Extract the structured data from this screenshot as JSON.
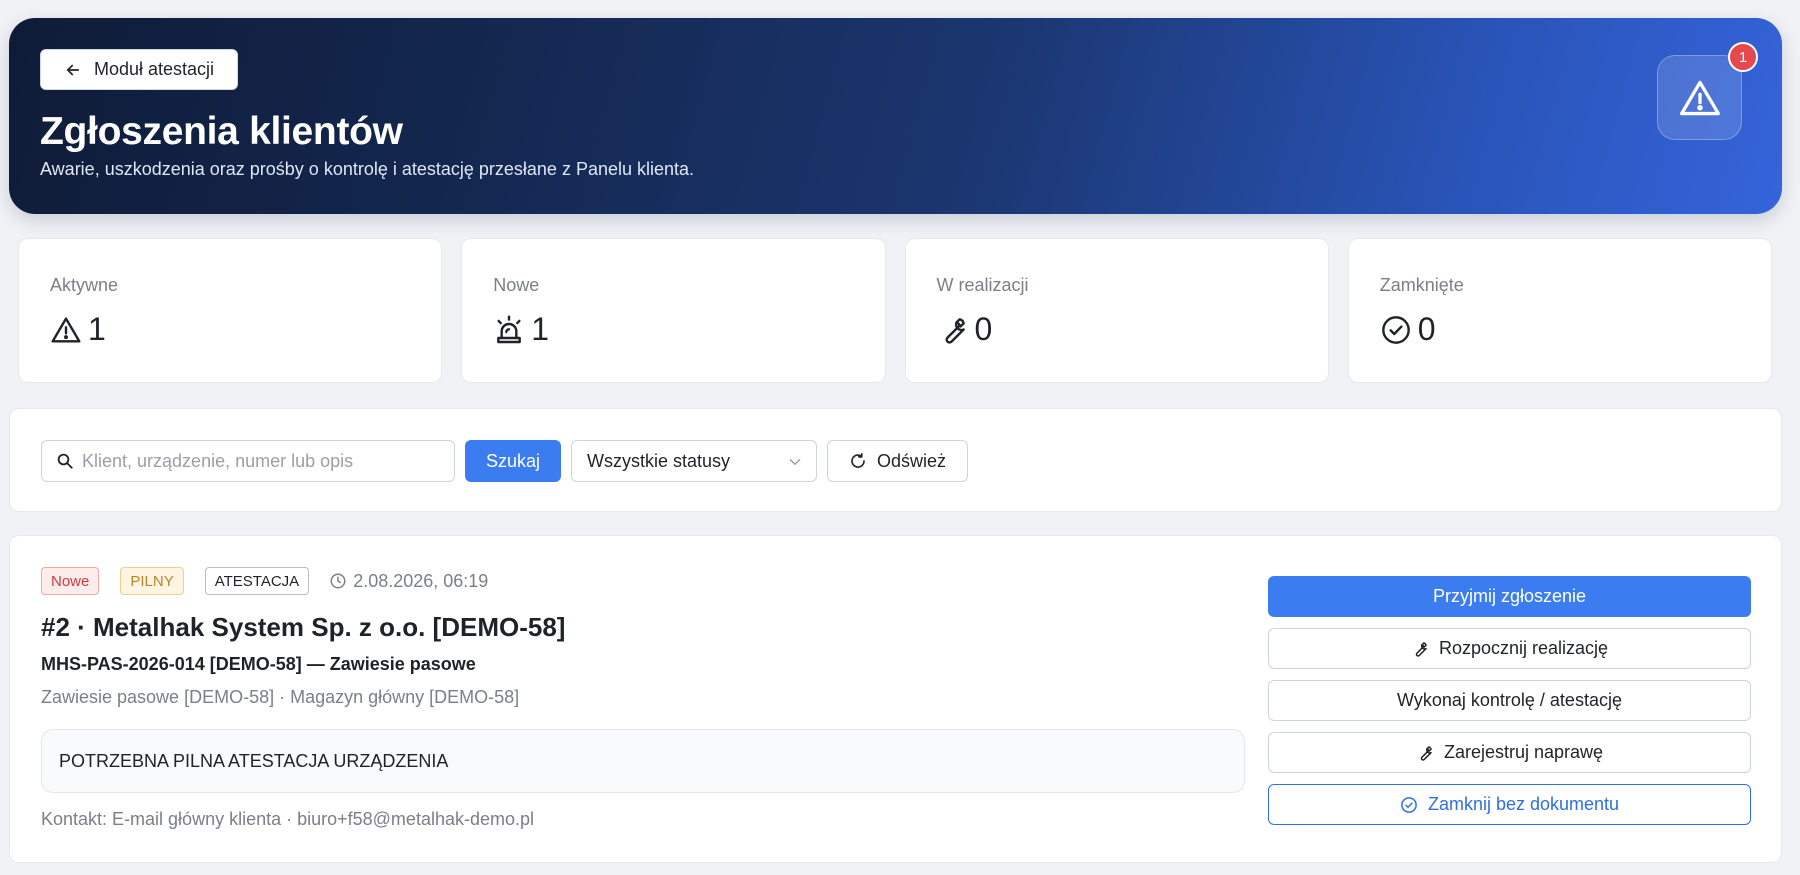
{
  "header": {
    "back_label": "Moduł atestacji",
    "title": "Zgłoszenia klientów",
    "subtitle": "Awarie, uszkodzenia oraz prośby o kontrolę i atestację przesłane z Panelu klienta.",
    "alert_icon": "warning-triangle-icon",
    "alert_count": "1"
  },
  "stats": [
    {
      "label": "Aktywne",
      "value": "1",
      "icon": "warning-triangle-icon"
    },
    {
      "label": "Nowe",
      "value": "1",
      "icon": "siren-icon"
    },
    {
      "label": "W realizacji",
      "value": "0",
      "icon": "wrench-icon"
    },
    {
      "label": "Zamknięte",
      "value": "0",
      "icon": "check-circle-icon"
    }
  ],
  "filters": {
    "search_placeholder": "Klient, urządzenie, numer lub opis",
    "search_value": "",
    "search_button": "Szukaj",
    "status_selected": "Wszystkie statusy",
    "refresh_button": "Odśwież"
  },
  "ticket": {
    "status_tag": "Nowe",
    "priority_tag": "PILNY",
    "type_tag": "ATESTACJA",
    "date": "2.08.2026, 06:19",
    "title": "#2 · Metalhak System Sp. z o.o. [DEMO-58]",
    "device": "MHS-PAS-2026-014 [DEMO-58] — Zawiesie pasowe",
    "location": "Zawiesie pasowe [DEMO-58] · Magazyn główny [DEMO-58]",
    "description": "POTRZEBNA PILNA ATESTACJA URZĄDZENIA",
    "contact": "Kontakt: E-mail główny klienta · biuro+f58@metalhak-demo.pl",
    "actions": {
      "accept": "Przyjmij zgłoszenie",
      "start": "Rozpocznij realizację",
      "inspect": "Wykonaj kontrolę / atestację",
      "repair": "Zarejestruj naprawę",
      "close": "Zamknij bez dokumentu"
    }
  },
  "colors": {
    "accent": "#3b7df0",
    "new_tag": "#d23b3b",
    "urgent_tag": "#b8862a",
    "alert_badge": "#e5484d"
  }
}
